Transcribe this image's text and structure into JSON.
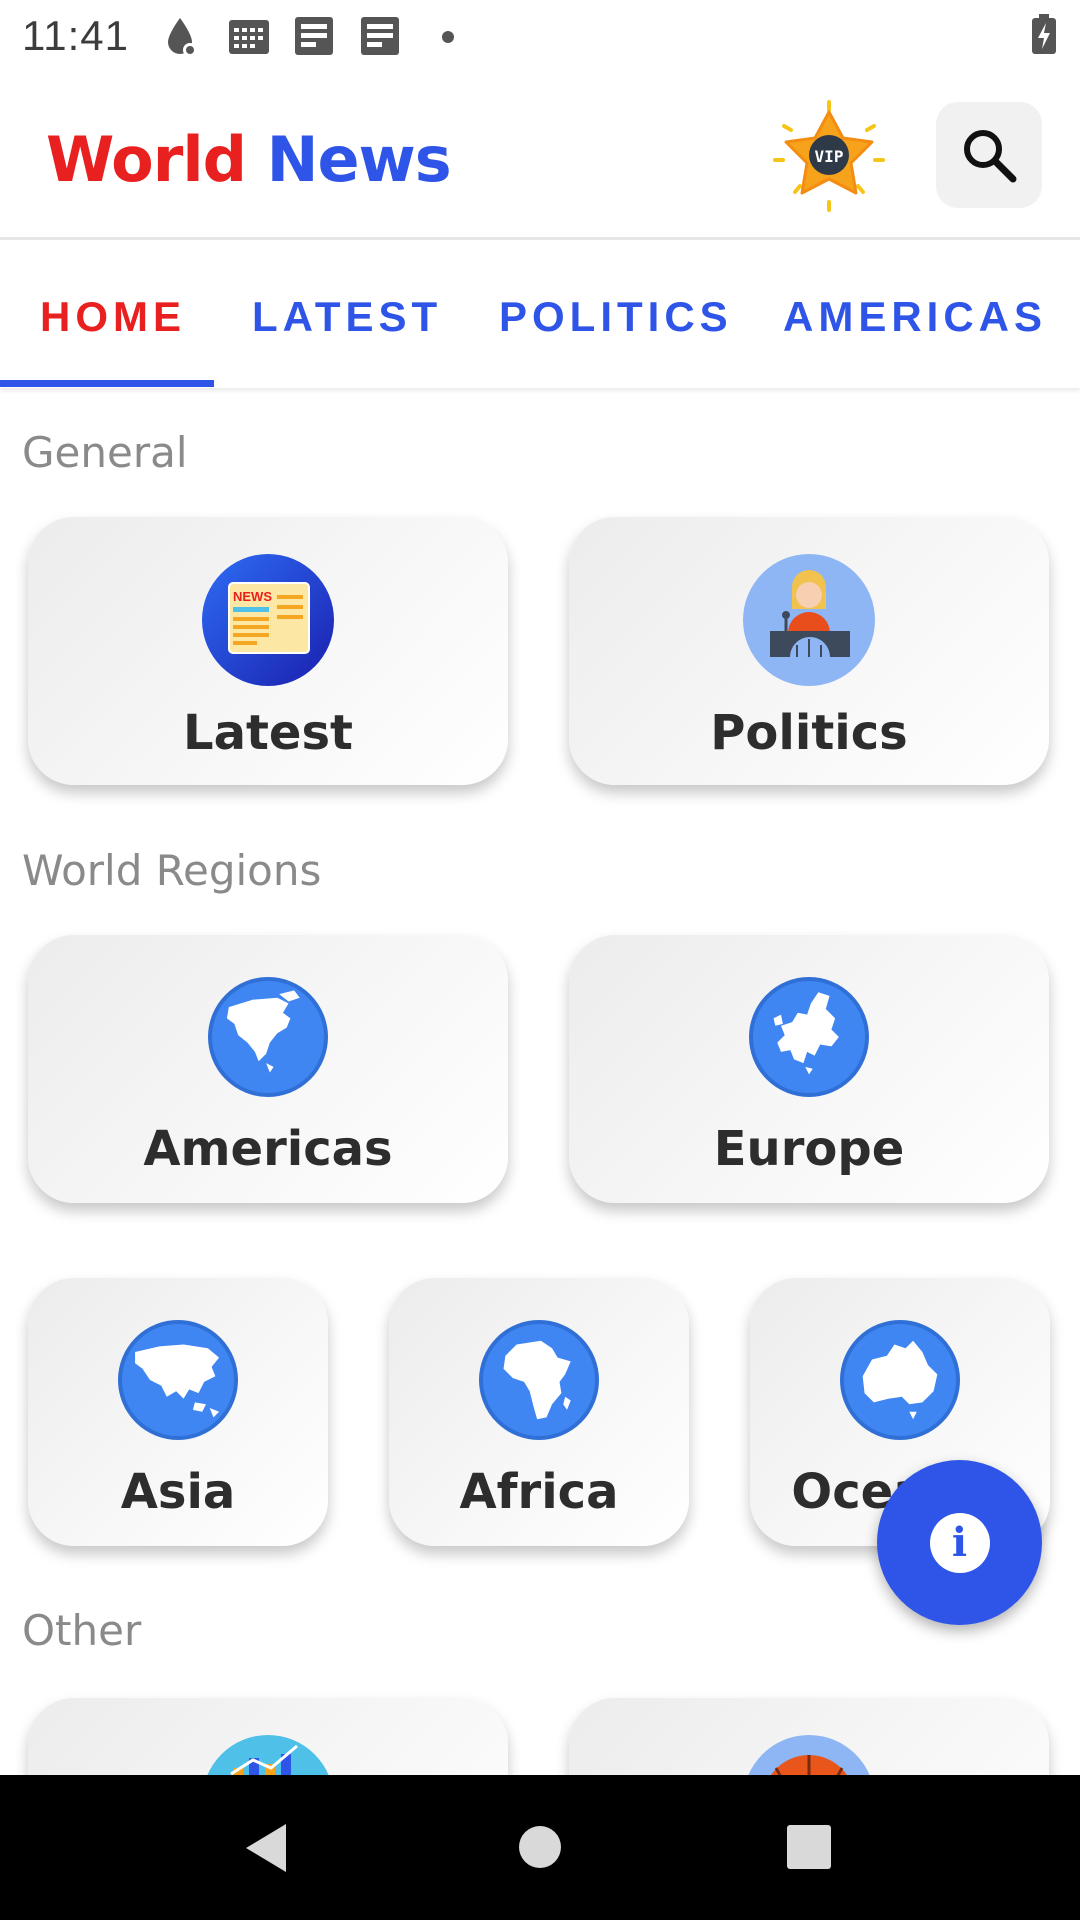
{
  "status_bar": {
    "time": "11:41"
  },
  "app": {
    "title_part1": "World",
    "title_part2": "News",
    "vip_label": "VIP"
  },
  "tabs": [
    {
      "label": "HOME",
      "active": true
    },
    {
      "label": "LATEST",
      "active": false
    },
    {
      "label": "POLITICS",
      "active": false
    },
    {
      "label": "AMERICAS",
      "active": false
    }
  ],
  "sections": {
    "general": {
      "title": "General",
      "cards": [
        {
          "label": "Latest",
          "icon": "newspaper-icon",
          "news_text": "NEWS"
        },
        {
          "label": "Politics",
          "icon": "speaker-podium-icon"
        }
      ]
    },
    "regions": {
      "title": "World Regions",
      "cards": [
        {
          "label": "Americas",
          "icon": "north-america-globe-icon"
        },
        {
          "label": "Europe",
          "icon": "europe-globe-icon"
        },
        {
          "label": "Asia",
          "icon": "asia-globe-icon"
        },
        {
          "label": "Africa",
          "icon": "africa-globe-icon"
        },
        {
          "label": "Oceania",
          "icon": "oceania-globe-icon"
        }
      ]
    },
    "other": {
      "title": "Other"
    }
  },
  "fab": {
    "icon": "info-icon",
    "glyph": "i"
  },
  "colors": {
    "accent_blue": "#2f55e8",
    "accent_red": "#e8201f",
    "globe_blue": "#3f86f2"
  }
}
